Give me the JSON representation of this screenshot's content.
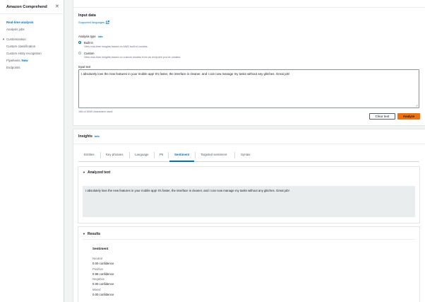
{
  "sidebar": {
    "title": "Amazon Comprehend",
    "close_icon": "✕",
    "items": [
      {
        "label": "Real-time analysis",
        "active": true
      },
      {
        "label": "Analysis jobs",
        "active": false
      }
    ],
    "section": {
      "label": "Customization",
      "caret": "▼"
    },
    "section_items": [
      {
        "label": "Custom classification"
      },
      {
        "label": "Custom entity recognition"
      },
      {
        "label": "Flywheels",
        "badge": "New"
      },
      {
        "label": "Endpoints"
      }
    ]
  },
  "input_panel": {
    "title": "Input data",
    "supported_languages": "Supported languages",
    "analysis_type_label": "Analysis type",
    "info": "Info",
    "options": [
      {
        "label": "Built-in",
        "description": "View real-time insights based on AWS built-in models.",
        "selected": true
      },
      {
        "label": "Custom",
        "description": "View real-time insights based on custom models from an endpoint you've created.",
        "selected": false
      }
    ],
    "input_text_label": "Input text",
    "input_text_value": "I absolutely love the new features in your mobile app! It's faster, the interface is cleaner, and I can now manage my tasks without any glitches. Great job!",
    "char_count": "156 of 5000 characters used.",
    "clear_button": "Clear text",
    "analyze_button": "Analyze"
  },
  "insights": {
    "title": "Insights",
    "info": "Info",
    "tabs": [
      "Entities",
      "Key phrases",
      "Language",
      "PII",
      "Sentiment",
      "Targeted sentiment",
      "Syntax"
    ],
    "active_tab": "Sentiment",
    "analyzed_text": {
      "title": "Analyzed text",
      "content": "I absolutely love the new features in your mobile app! It's faster, the interface is cleaner, and I can now manage my tasks without any glitches. Great job!"
    },
    "results": {
      "title": "Results",
      "heading": "Sentiment",
      "rows": [
        {
          "label": "Neutral",
          "value": "0.00 confidence"
        },
        {
          "label": "Positive",
          "value": "0.99 confidence"
        },
        {
          "label": "Negative",
          "value": "0.00 confidence"
        },
        {
          "label": "Mixed",
          "value": "0.00 confidence"
        }
      ]
    }
  },
  "colors": {
    "link": "#0073bb",
    "accent": "#ec7211",
    "border": "#d5dbdb",
    "page_bg": "#f2f3f3"
  }
}
